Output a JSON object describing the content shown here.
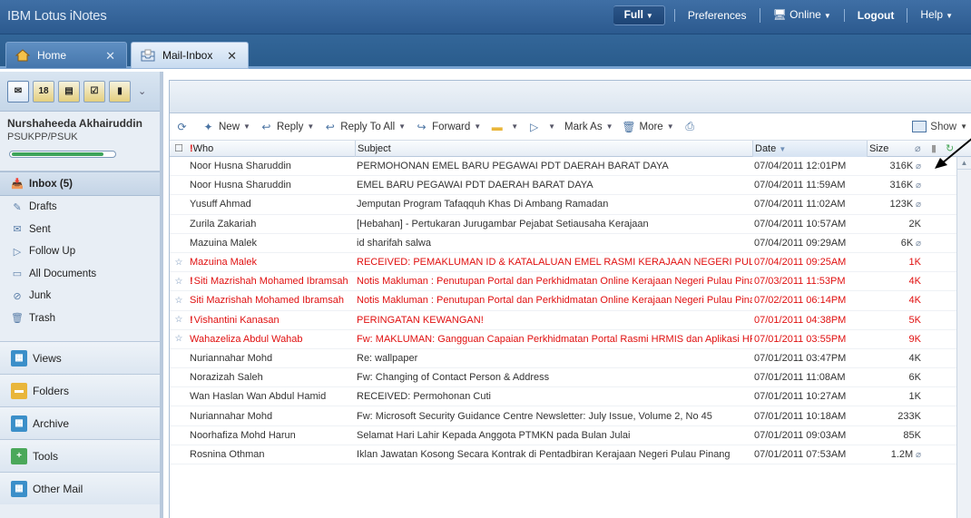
{
  "app": {
    "brand": "IBM Lotus iNotes"
  },
  "topnav": {
    "full": "Full",
    "preferences": "Preferences",
    "online": "Online",
    "logout": "Logout",
    "help": "Help"
  },
  "tabs": [
    {
      "label": "Home"
    },
    {
      "label": "Mail-Inbox"
    }
  ],
  "user": {
    "name": "Nurshaheeda Akhairuddin",
    "org": "PSUKPP/PSUK",
    "quota_fraction": 0.9
  },
  "folders": [
    {
      "label": "Inbox (5)",
      "icon": "inbox-icon"
    },
    {
      "label": "Drafts",
      "icon": "drafts-icon"
    },
    {
      "label": "Sent",
      "icon": "sent-icon"
    },
    {
      "label": "Follow Up",
      "icon": "flag-icon"
    },
    {
      "label": "All Documents",
      "icon": "documents-icon"
    },
    {
      "label": "Junk",
      "icon": "junk-icon"
    },
    {
      "label": "Trash",
      "icon": "trash-icon"
    }
  ],
  "sections": [
    {
      "label": "Views",
      "icon": "views-icon"
    },
    {
      "label": "Folders",
      "icon": "folder-icon"
    },
    {
      "label": "Archive",
      "icon": "archive-icon"
    },
    {
      "label": "Tools",
      "icon": "tools-icon"
    },
    {
      "label": "Other Mail",
      "icon": "other-mail-icon"
    }
  ],
  "toolbar": {
    "new": "New",
    "reply": "Reply",
    "reply_all": "Reply To All",
    "forward": "Forward",
    "mark_as": "Mark As",
    "more": "More",
    "show": "Show"
  },
  "columns": {
    "who": "Who",
    "subject": "Subject",
    "date": "Date",
    "size": "Size"
  },
  "messages": [
    {
      "who": "Noor Husna Sharuddin",
      "subject": "PERMOHONAN EMEL BARU PEGAWAI PDT DAERAH BARAT DAYA",
      "date": "07/04/2011 12:01PM",
      "size": "316K",
      "attachment": true,
      "star": false,
      "flag": false,
      "red": false
    },
    {
      "who": "Noor Husna Sharuddin",
      "subject": "EMEL BARU PEGAWAI PDT DAERAH BARAT DAYA",
      "date": "07/04/2011 11:59AM",
      "size": "316K",
      "attachment": true,
      "star": false,
      "flag": false,
      "red": false
    },
    {
      "who": "Yusuff Ahmad",
      "subject": "Jemputan Program Tafaqquh Khas Di Ambang Ramadan",
      "date": "07/04/2011 11:02AM",
      "size": "123K",
      "attachment": true,
      "star": false,
      "flag": false,
      "red": false
    },
    {
      "who": "Zurila Zakariah",
      "subject": "[Hebahan] - Pertukaran Jurugambar Pejabat Setiausaha Kerajaan",
      "date": "07/04/2011 10:57AM",
      "size": "2K",
      "attachment": false,
      "star": false,
      "flag": false,
      "red": false
    },
    {
      "who": "Mazuina Malek",
      "subject": "id sharifah salwa",
      "date": "07/04/2011 09:29AM",
      "size": "6K",
      "attachment": true,
      "star": false,
      "flag": false,
      "red": false
    },
    {
      "who": "Mazuina Malek",
      "subject": "RECEIVED: PEMAKLUMAN ID & KATALALUAN EMEL RASMI KERAJAAN NEGERI PULAU",
      "date": "07/04/2011 09:25AM",
      "size": "1K",
      "attachment": false,
      "star": true,
      "flag": false,
      "red": true
    },
    {
      "who": "Siti Mazrishah Mohamed Ibramsah",
      "subject": "Notis Makluman : Penutupan Portal dan Perkhidmatan Online Kerajaan Negeri Pulau Pinar",
      "date": "07/03/2011 11:53PM",
      "size": "4K",
      "attachment": false,
      "star": true,
      "flag": true,
      "red": true
    },
    {
      "who": "Siti Mazrishah Mohamed Ibramsah",
      "subject": "Notis Makluman : Penutupan Portal dan Perkhidmatan Online Kerajaan Negeri Pulau Pinar",
      "date": "07/02/2011 06:14PM",
      "size": "4K",
      "attachment": false,
      "star": true,
      "flag": false,
      "red": true
    },
    {
      "who": "Vishantini Kanasan",
      "subject": "PERINGATAN KEWANGAN!",
      "date": "07/01/2011 04:38PM",
      "size": "5K",
      "attachment": false,
      "star": true,
      "flag": true,
      "red": true
    },
    {
      "who": "Wahazeliza Abdul Wahab",
      "subject": "Fw: MAKLUMAN: Gangguan Capaian Perkhidmatan Portal Rasmi HRMIS dan Aplikasi HR",
      "date": "07/01/2011 03:55PM",
      "size": "9K",
      "attachment": false,
      "star": true,
      "flag": false,
      "red": true
    },
    {
      "who": "Nuriannahar Mohd",
      "subject": "Re: wallpaper",
      "date": "07/01/2011 03:47PM",
      "size": "4K",
      "attachment": false,
      "star": false,
      "flag": false,
      "red": false
    },
    {
      "who": "Norazizah Saleh",
      "subject": "Fw: Changing of Contact Person & Address",
      "date": "07/01/2011 11:08AM",
      "size": "6K",
      "attachment": false,
      "star": false,
      "flag": false,
      "red": false
    },
    {
      "who": "Wan Haslan Wan Abdul Hamid",
      "subject": "RECEIVED: Permohonan Cuti",
      "date": "07/01/2011 10:27AM",
      "size": "1K",
      "attachment": false,
      "star": false,
      "flag": false,
      "red": false
    },
    {
      "who": "Nuriannahar Mohd",
      "subject": "Fw: Microsoft Security Guidance Centre Newsletter: July Issue, Volume 2, No 45",
      "date": "07/01/2011 10:18AM",
      "size": "233K",
      "attachment": false,
      "star": false,
      "flag": false,
      "red": false
    },
    {
      "who": "Noorhafiza Mohd Harun",
      "subject": "Selamat Hari Lahir Kepada Anggota PTMKN pada Bulan Julai",
      "date": "07/01/2011 09:03AM",
      "size": "85K",
      "attachment": false,
      "star": false,
      "flag": false,
      "red": false
    },
    {
      "who": "Rosnina Othman",
      "subject": "Iklan Jawatan Kosong Secara Kontrak di Pentadbiran Kerajaan Negeri Pulau Pinang",
      "date": "07/01/2011 07:53AM",
      "size": "1.2M",
      "attachment": true,
      "star": false,
      "flag": false,
      "red": false
    }
  ]
}
